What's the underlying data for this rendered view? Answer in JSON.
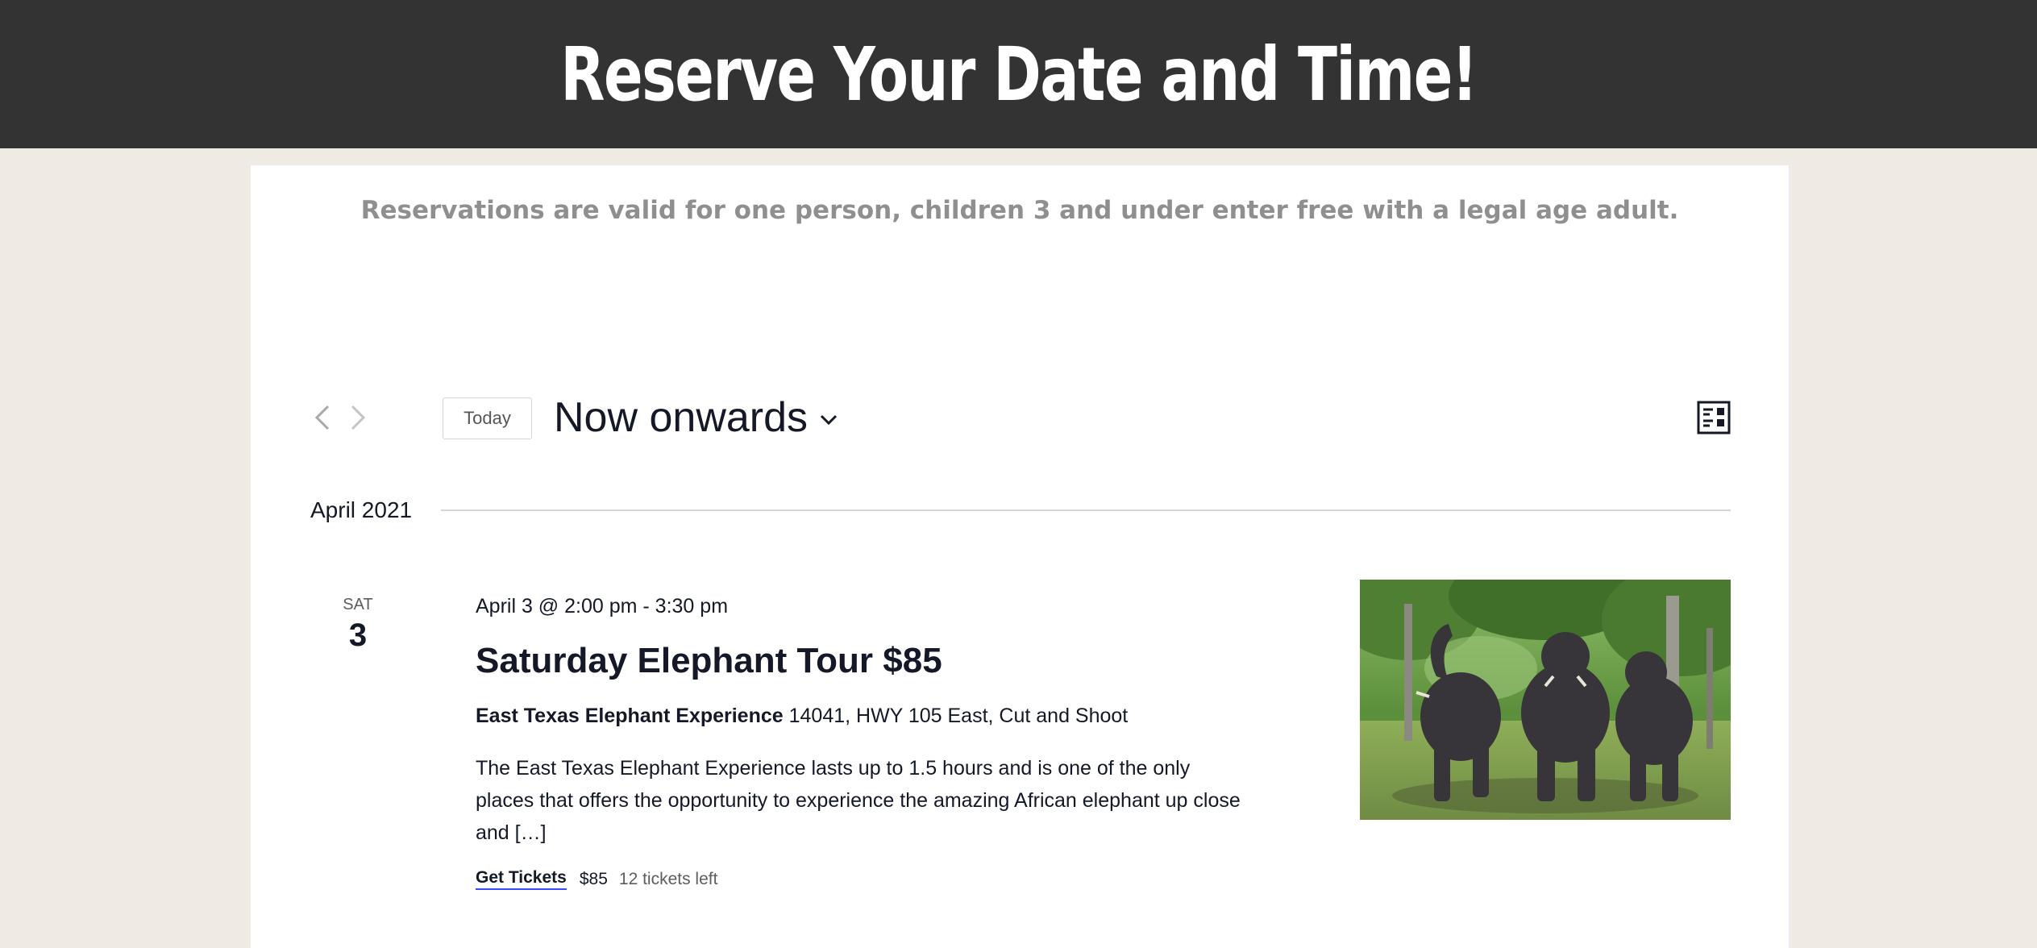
{
  "header": {
    "title": "Reserve Your Date and Time!"
  },
  "notice": {
    "text": "Reservations are valid for one person, children 3 and under enter free with a legal age adult."
  },
  "toolbar": {
    "prev_icon": "chevron-left-icon",
    "next_icon": "chevron-right-icon",
    "today_label": "Today",
    "range_label": "Now onwards",
    "view_icon": "list-view-icon"
  },
  "month": {
    "label": "April 2021"
  },
  "event": {
    "dow": "Sat",
    "day": "3",
    "time": "April 3 @ 2:00 pm - 3:30 pm",
    "title": "Saturday Elephant Tour $85",
    "venue_name": "East Texas Elephant Experience",
    "venue_address": " 14041, HWY 105 East, Cut and Shoot",
    "description": "The East Texas Elephant Experience lasts up to 1.5 hours and is one of the only places that offers the opportunity to experience the amazing African elephant up close and […]",
    "tickets_label": "Get Tickets",
    "price": "$85",
    "tickets_left": "12 tickets left",
    "image_alt": "elephants-photo"
  },
  "colors": {
    "header_bg": "#333333",
    "page_bg": "#efebe4",
    "text_dark": "#141827",
    "notice_gray": "#8f8f8f",
    "link_accent": "#334aff"
  }
}
